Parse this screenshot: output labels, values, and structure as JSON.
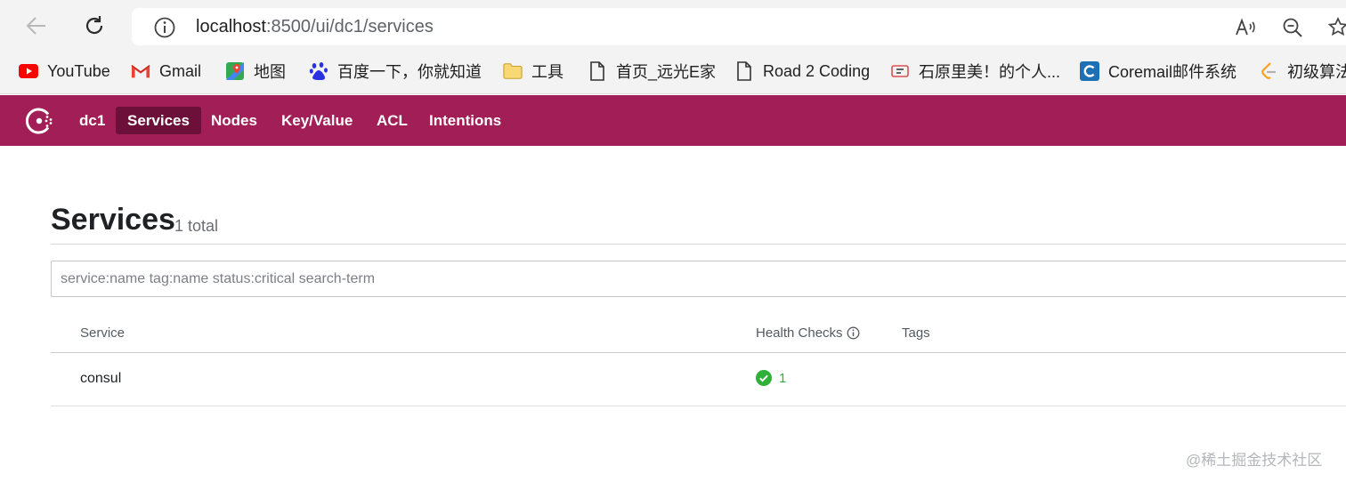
{
  "browser": {
    "url_host": "localhost",
    "url_rest": ":8500/ui/dc1/services",
    "bookmarks": [
      {
        "label": "YouTube",
        "icon": "youtube-icon"
      },
      {
        "label": "Gmail",
        "icon": "gmail-icon"
      },
      {
        "label": "地图",
        "icon": "maps-icon"
      },
      {
        "label": "百度一下，你就知道",
        "icon": "baidu-icon"
      },
      {
        "label": "工具",
        "icon": "folder-icon"
      },
      {
        "label": "首页_远光E家",
        "icon": "page-icon"
      },
      {
        "label": "Road 2 Coding",
        "icon": "page-icon"
      },
      {
        "label": "石原里美！的个人...",
        "icon": "blog-icon"
      },
      {
        "label": "Coremail邮件系统",
        "icon": "coremail-icon"
      },
      {
        "label": "初级算法",
        "icon": "leetcode-icon"
      }
    ]
  },
  "consul": {
    "brand_color": "#a21e56",
    "active_color": "#6d1039",
    "datacenter": "dc1",
    "nav": [
      "Services",
      "Nodes",
      "Key/Value",
      "ACL",
      "Intentions"
    ],
    "active_nav": "Services"
  },
  "main": {
    "title": "Services",
    "total": "1 total",
    "search_placeholder": "service:name tag:name status:critical search-term",
    "columns": {
      "service": "Service",
      "health": "Health Checks",
      "tags": "Tags"
    },
    "rows": [
      {
        "service": "consul",
        "health_passing": "1",
        "tags": ""
      }
    ]
  },
  "watermark": "@稀土掘金技术社区"
}
